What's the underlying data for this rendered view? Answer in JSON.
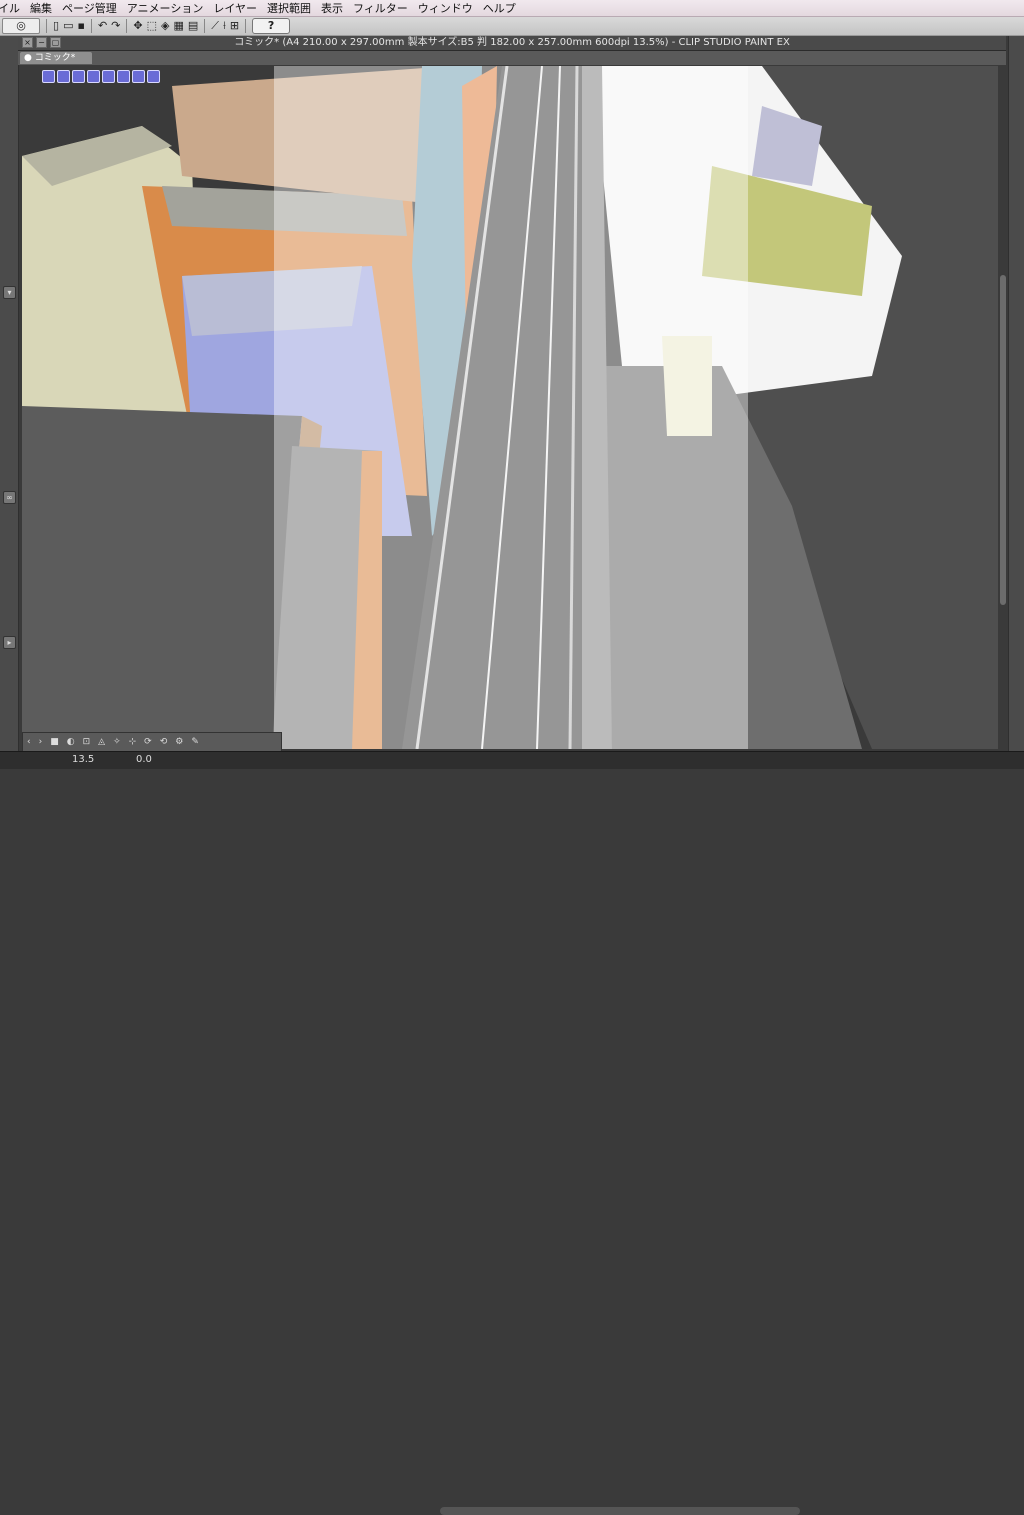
{
  "menubar": {
    "items": [
      "イル",
      "編集",
      "ページ管理",
      "アニメーション",
      "レイヤー",
      "選択範囲",
      "表示",
      "フィルター",
      "ウィンドウ",
      "ヘルプ"
    ]
  },
  "toolbar": {
    "help_label": "?"
  },
  "document": {
    "window_title": "コミック* (A4 210.00 x 297.00mm 製本サイズ:B5 判 182.00 x 257.00mm 600dpi 13.5%)  - CLIP STUDIO PAINT EX",
    "tab_label": "● コミック*"
  },
  "status": {
    "zoom": "13.5",
    "angle": "0.0"
  },
  "colors": {
    "page_highlight": "#ffffff",
    "canvas_bg": "#3a3a3a",
    "building_blue": "#9fa6e0",
    "building_orange": "#e0894a",
    "road": "#4a4a4a"
  }
}
